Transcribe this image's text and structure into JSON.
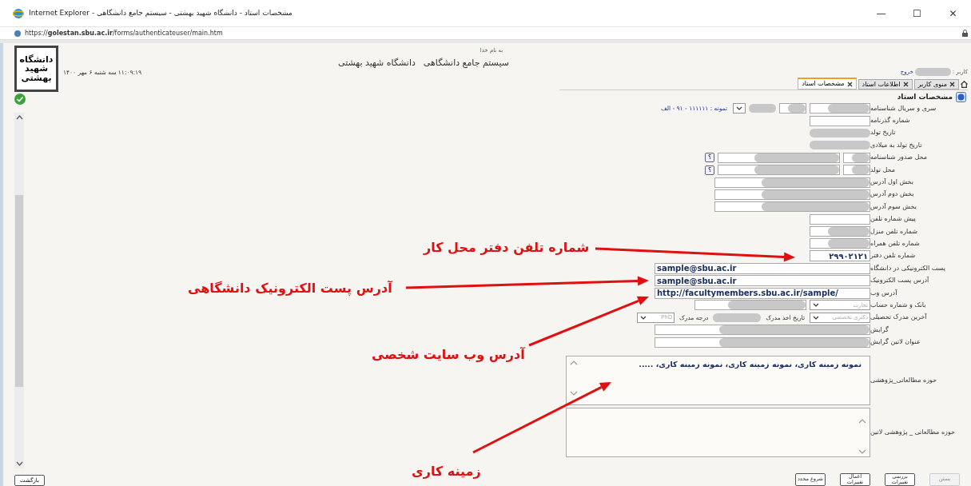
{
  "window": {
    "title": "مشخصات استاد - دانشگاه شهید بهشتی - سیستم جامع دانشگاهی - Internet Explorer",
    "controls": [
      "✕",
      "☐",
      "—"
    ]
  },
  "address_bar": {
    "url": "https://**golestan.sbu.ac.ir**/forms/authenticateuser/main.htm"
  },
  "header": {
    "logo_text": "دانشگاه شهید بهشتی",
    "datetime": "۱۱:۰۹:۱۹ سه شنبه ۶ مهر ۱۴۰۰",
    "bismillah": "به نام خدا",
    "system_title": "سیستم جامع دانشگاهی",
    "university": "دانشگاه شهید بهشتی"
  },
  "user": {
    "label": "کاربر :",
    "logout": "خروج"
  },
  "tabs": [
    {
      "label": "منوی کاربر",
      "selected": false
    },
    {
      "label": "اطلاعات استاد",
      "selected": false
    },
    {
      "label": "مشخصات استاد",
      "selected": true
    }
  ],
  "section_title": "مشخصات استاد",
  "rows": [
    {
      "label": "سری و سریال شناسنامه",
      "controls": [
        {
          "kind": "input",
          "redacted": true
        },
        {
          "kind": "input",
          "redacted": true
        },
        {
          "kind": "blur"
        },
        {
          "kind": "select"
        },
        {
          "kind": "hint",
          "text": "نمونه : ۱۱۱۱۱۱ - ۹۱ - الف"
        }
      ]
    },
    {
      "label": "شماره گذرنامه",
      "controls": [
        {
          "kind": "input",
          "redacted": false
        }
      ]
    },
    {
      "label": "تاریخ تولد",
      "controls": [
        {
          "kind": "blur"
        }
      ]
    },
    {
      "label": "تاریخ تولد به میلادی",
      "controls": [
        {
          "kind": "blur"
        }
      ]
    },
    {
      "label": "محل صدور شناسنامه",
      "controls": [
        {
          "kind": "input",
          "redacted": true
        },
        {
          "kind": "input",
          "redacted": true
        },
        {
          "kind": "help",
          "text": "؟"
        }
      ]
    },
    {
      "label": "محل تولد",
      "controls": [
        {
          "kind": "input",
          "redacted": true
        },
        {
          "kind": "input",
          "redacted": true
        },
        {
          "kind": "help",
          "text": "؟"
        }
      ]
    },
    {
      "label": "بخش اول آدرس",
      "controls": [
        {
          "kind": "input",
          "redacted": true
        }
      ]
    },
    {
      "label": "بخش دوم آدرس",
      "controls": [
        {
          "kind": "input",
          "redacted": true
        }
      ]
    },
    {
      "label": "بخش سوم آدرس",
      "controls": [
        {
          "kind": "input",
          "redacted": true
        }
      ]
    },
    {
      "label": "پیش شماره تلفن",
      "controls": [
        {
          "kind": "input",
          "redacted": false
        }
      ]
    },
    {
      "label": "شماره تلفن منزل",
      "controls": [
        {
          "kind": "input",
          "redacted": true
        }
      ]
    },
    {
      "label": "شماره تلفن همراه",
      "controls": [
        {
          "kind": "input",
          "redacted": true
        }
      ]
    },
    {
      "label": "شماره تلفن دفتر",
      "controls": [
        {
          "kind": "input",
          "value": "۲۹۹۰۲۱۲۱"
        }
      ]
    },
    {
      "label": "پست الکترونیکی در دانشگاه",
      "controls": [
        {
          "kind": "input",
          "value": "sample@sbu.ac.ir"
        }
      ]
    },
    {
      "label": "آدرس پست الکترونیک",
      "controls": [
        {
          "kind": "input",
          "value": "sample@sbu.ac.ir"
        }
      ]
    },
    {
      "label": "آدرس وب",
      "controls": [
        {
          "kind": "input",
          "value": "http://facultymembers.sbu.ac.ir/sample/"
        }
      ]
    },
    {
      "label": "بانک و شماره حساب",
      "controls": [
        {
          "kind": "select",
          "value": "تجارت"
        },
        {
          "kind": "input",
          "redacted": true
        }
      ]
    },
    {
      "label": "آخرین مدرک تحصیلی",
      "controls": [
        {
          "kind": "select",
          "value": "دکتری تخصصی"
        },
        {
          "kind": "label",
          "text": "تاریخ اخذ مدرک"
        },
        {
          "kind": "blur"
        },
        {
          "kind": "label",
          "text": "درجه مدرک"
        },
        {
          "kind": "select",
          "value": "PhD"
        }
      ]
    },
    {
      "label": "گرایش",
      "controls": [
        {
          "kind": "input",
          "redacted": true
        }
      ]
    },
    {
      "label": "عنوان لاتین گرایش",
      "controls": [
        {
          "kind": "input",
          "redacted": true
        }
      ]
    }
  ],
  "textareas": [
    {
      "label": "حوزه مطالعاتی_پژوهشی",
      "value": "نمونه زمینه کاری، نمونه زمینه کاری، نمونه زمینه کاری، ....."
    },
    {
      "label": "حوزه مطالعاتی _ پژوهشی لاتین"
    }
  ],
  "buttons": [
    {
      "label": "بستن",
      "disabled": true
    },
    {
      "label": "بررسی تغییرات",
      "disabled": false
    },
    {
      "label": "اعمال تغییرات",
      "disabled": false
    },
    {
      "label": "شروع مجدد",
      "disabled": false
    }
  ],
  "back_button": "بازگشت",
  "annotations": [
    {
      "text": "شماره تلفن دفتر محل کار"
    },
    {
      "text": "آدرس پست الکترونیک دانشگاهی"
    },
    {
      "text": "آدرس وب سایت شخصی"
    },
    {
      "text": "زمینه کاری"
    }
  ]
}
